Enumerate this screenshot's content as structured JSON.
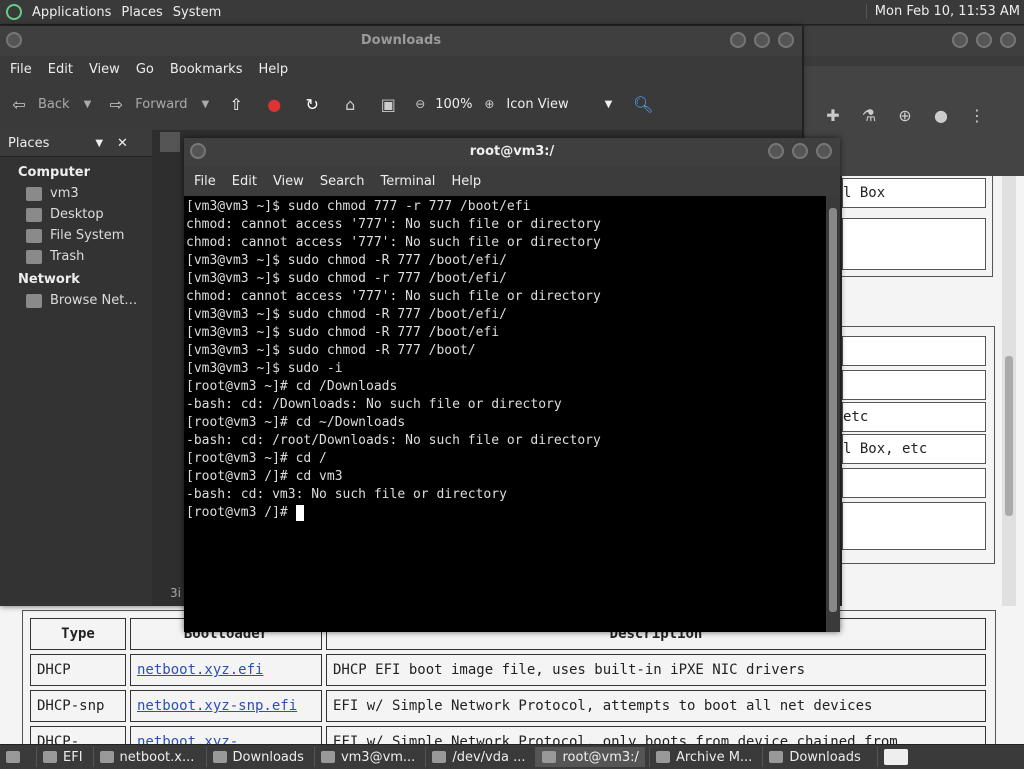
{
  "top_panel": {
    "menus": [
      "Applications",
      "Places",
      "System"
    ],
    "clock": "Mon Feb 10, 11:53 AM"
  },
  "file_manager": {
    "title": "Downloads",
    "menus": [
      "File",
      "Edit",
      "View",
      "Go",
      "Bookmarks",
      "Help"
    ],
    "toolbar": {
      "back": "Back",
      "forward": "Forward",
      "zoom": "100%",
      "view_mode": "Icon View"
    },
    "sidebar": {
      "header": "Places",
      "computer_label": "Computer",
      "computer_items": [
        "vm3",
        "Desktop",
        "File System",
        "Trash"
      ],
      "network_label": "Network",
      "network_items": [
        "Browse Net…"
      ]
    },
    "status_fragment": "3i"
  },
  "terminal": {
    "title": "root@vm3:/",
    "menus": [
      "File",
      "Edit",
      "View",
      "Search",
      "Terminal",
      "Help"
    ],
    "lines": [
      "[vm3@vm3 ~]$ sudo chmod 777 -r 777 /boot/efi",
      "chmod: cannot access '777': No such file or directory",
      "chmod: cannot access '777': No such file or directory",
      "[vm3@vm3 ~]$ sudo chmod -R 777 /boot/efi/",
      "[vm3@vm3 ~]$ sudo chmod -r 777 /boot/efi/",
      "chmod: cannot access '777': No such file or directory",
      "[vm3@vm3 ~]$ sudo chmod -R 777 /boot/efi/",
      "[vm3@vm3 ~]$ sudo chmod -R 777 /boot/efi",
      "[vm3@vm3 ~]$ sudo chmod -R 777 /boot/",
      "[vm3@vm3 ~]$ sudo -i",
      "[root@vm3 ~]# cd /Downloads",
      "-bash: cd: /Downloads: No such file or directory",
      "[root@vm3 ~]# cd ~/Downloads",
      "-bash: cd: /root/Downloads: No such file or directory",
      "[root@vm3 ~]# cd /",
      "[root@vm3 /]# cd vm3",
      "-bash: cd: vm3: No such file or directory"
    ],
    "prompt": "[root@vm3 /]# "
  },
  "browser": {
    "right_fragments": [
      "l Box",
      "etc",
      "l Box, etc"
    ],
    "table": {
      "headers": [
        "Type",
        "Bootloader",
        "Description"
      ],
      "rows": [
        {
          "type": "DHCP",
          "bootloader": "netboot.xyz.efi",
          "description": "DHCP EFI boot image file, uses built-in iPXE NIC drivers"
        },
        {
          "type": "DHCP-snp",
          "bootloader": "netboot.xyz-snp.efi",
          "description": "EFI w/ Simple Network Protocol, attempts to boot all net devices"
        },
        {
          "type": "DHCP-",
          "bootloader": "netboot.xyz-",
          "description": "EFI w/ Simple Network Protocol, only boots from device chained from"
        }
      ]
    }
  },
  "taskbar": {
    "items": [
      "EFI",
      "netboot.x...",
      "Downloads",
      "vm3@vm...",
      "/dev/vda ...",
      "root@vm3:/",
      "Archive M...",
      "Downloads"
    ]
  }
}
